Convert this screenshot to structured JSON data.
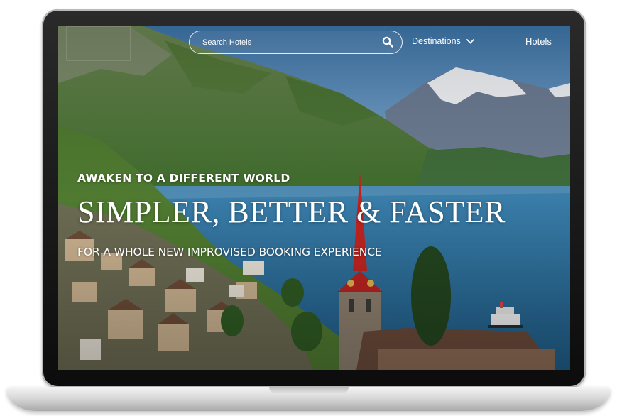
{
  "nav": {
    "search_placeholder": "Search Hotels",
    "destinations_label": "Destinations",
    "hotels_label": "Hotels"
  },
  "hero": {
    "eyebrow": "AWAKEN TO A DIFFERENT WORLD",
    "headline": "SIMPLER, BETTER & FASTER",
    "subline": "FOR A WHOLE NEW IMPROVISED BOOKING EXPERIENCE"
  },
  "icons": {
    "search": "search-icon",
    "chevron": "chevron-down-icon"
  },
  "colors": {
    "text": "#ffffff",
    "lake": "#2e6f9e",
    "sky": "#4f86b8"
  }
}
